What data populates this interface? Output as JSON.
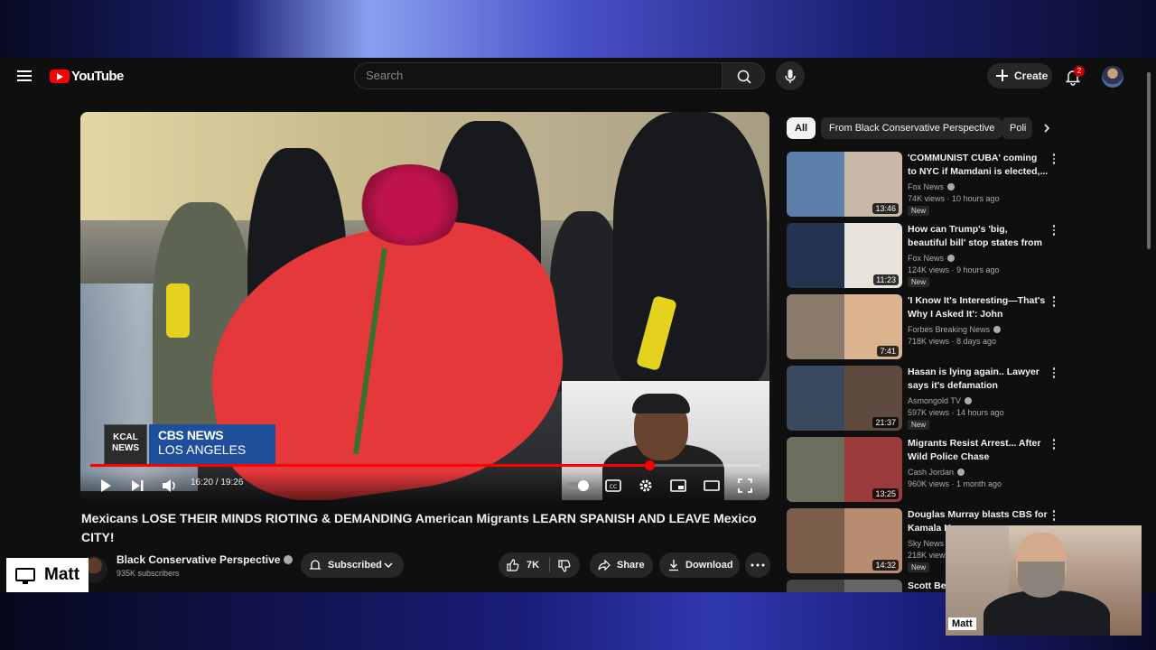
{
  "header": {
    "logo_text": "YouTube",
    "search_placeholder": "Search",
    "create_label": "Create",
    "notification_count": "2"
  },
  "player": {
    "time_display": "16:20 / 19:26",
    "progress_fraction": 0.835,
    "overlay": {
      "station_logo": "KCAL NEWS",
      "network_line1": "CBS NEWS",
      "network_line2": "LOS ANGELES"
    }
  },
  "video": {
    "title": "Mexicans LOSE THEIR MINDS RIOTING & DEMANDING American Migrants LEARN SPANISH AND LEAVE Mexico CITY!",
    "channel_name": "Black Conservative Perspective",
    "subscribers": "935K subscribers",
    "subscribe_label": "Subscribed",
    "like_count": "7K",
    "share_label": "Share",
    "download_label": "Download"
  },
  "chips": [
    {
      "label": "All",
      "active": true
    },
    {
      "label": "From Black Conservative Perspective",
      "active": false
    },
    {
      "label": "Poli",
      "active": false
    }
  ],
  "recommendations": [
    {
      "title": "'COMMUNIST CUBA' coming to NYC if Mamdani is elected,...",
      "channel": "Fox News",
      "views": "74K views",
      "age": "10 hours ago",
      "badge": "New",
      "duration": "13:46",
      "colors": [
        "#5b7fa8",
        "#c9b9a8"
      ]
    },
    {
      "title": "How can Trump's 'big, beautiful bill' stop states from 'gaming...",
      "channel": "Fox News",
      "views": "124K views",
      "age": "9 hours ago",
      "badge": "New",
      "duration": "11:23",
      "colors": [
        "#22344f",
        "#e8e4dc"
      ]
    },
    {
      "title": "'I Know It's Interesting—That's Why I Asked It': John Kennedy...",
      "channel": "Forbes Breaking News",
      "views": "718K views",
      "age": "8 days ago",
      "badge": "",
      "duration": "7:41",
      "colors": [
        "#8b7b6c",
        "#d9b48f"
      ]
    },
    {
      "title": "Hasan is lying again.. Lawyer says it's defamation",
      "channel": "Asmongold TV",
      "views": "597K views",
      "age": "14 hours ago",
      "badge": "New",
      "duration": "21:37",
      "colors": [
        "#3a4a5e",
        "#5e4a3e"
      ]
    },
    {
      "title": "Migrants Resist Arrest... After Wild Police Chase",
      "channel": "Cash Jordan",
      "views": "960K views",
      "age": "1 month ago",
      "badge": "",
      "duration": "13:25",
      "colors": [
        "#6e6e5e",
        "#9a3a3a"
      ]
    },
    {
      "title": "Douglas Murray blasts CBS for Kamala H...",
      "channel": "Sky News",
      "views": "218K views",
      "age": "",
      "badge": "New",
      "duration": "14:32",
      "colors": [
        "#7a5d4a",
        "#b88c70"
      ]
    },
    {
      "title": "Scott Be...",
      "channel": "",
      "views": "",
      "age": "",
      "badge": "",
      "duration": "",
      "colors": [
        "#444",
        "#666"
      ]
    }
  ],
  "overlay_left": {
    "name": "Matt"
  },
  "webcam": {
    "label": "Matt"
  }
}
